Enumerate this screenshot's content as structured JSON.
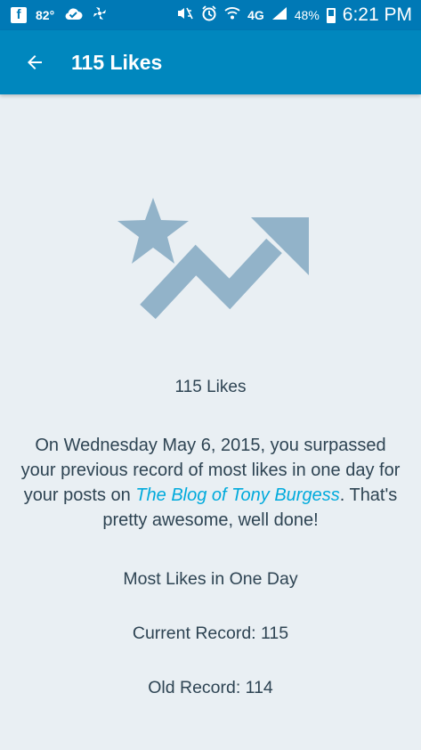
{
  "status_bar": {
    "temperature": "82°",
    "network": "4G",
    "battery": "48%",
    "time": "6:21 PM",
    "icons": [
      "facebook-icon",
      "cloud-check-icon",
      "pinwheel-icon",
      "mute-icon",
      "alarm-icon",
      "wifi-icon",
      "signal-icon",
      "battery-icon"
    ]
  },
  "app_bar": {
    "title": "115 Likes",
    "background": "#0087be",
    "back_icon": "arrow-left-icon"
  },
  "hero": {
    "icon": "star-trend-up-icon",
    "color": "#92b3c9"
  },
  "content": {
    "count_title": "115 Likes",
    "desc_prefix": "On Wednesday May 6, 2015, you surpassed your previous record of most likes in one day for your posts on ",
    "blog_name": "The Blog of Tony Burgess",
    "desc_suffix": ". That's pretty awesome, well done!",
    "section_heading": "Most Likes in One Day",
    "current_record": "Current Record: 115",
    "old_record": "Old Record: 114",
    "link_color": "#00aadc"
  }
}
